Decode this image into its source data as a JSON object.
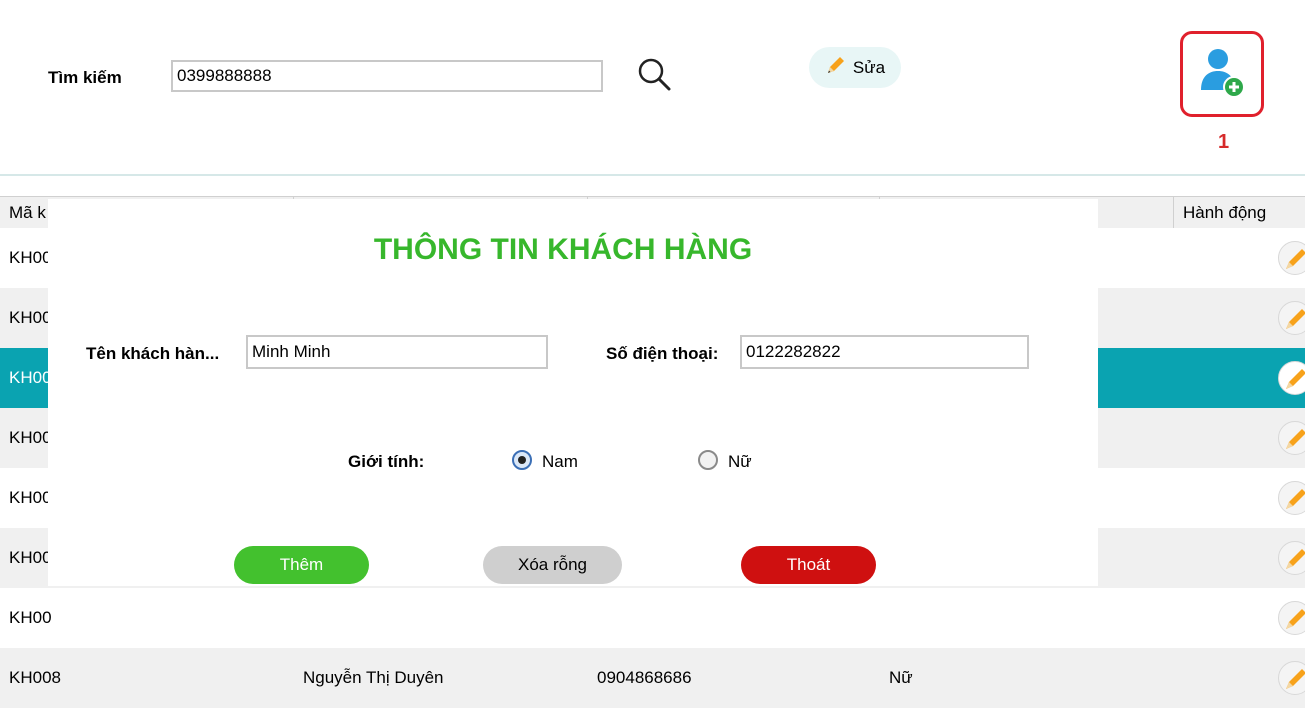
{
  "search": {
    "label": "Tìm kiếm",
    "value": "0399888888"
  },
  "toolbar": {
    "edit_label": "Sửa",
    "step_marker": "1"
  },
  "table": {
    "headers": [
      "Mã k",
      "",
      "",
      "",
      "Hành động"
    ],
    "rows": [
      {
        "id": "KH00",
        "name": "",
        "phone": "",
        "gender": ""
      },
      {
        "id": "KH00",
        "name": "",
        "phone": "",
        "gender": ""
      },
      {
        "id": "KH00",
        "name": "",
        "phone": "",
        "gender": ""
      },
      {
        "id": "KH00",
        "name": "",
        "phone": "",
        "gender": ""
      },
      {
        "id": "KH00",
        "name": "",
        "phone": "",
        "gender": ""
      },
      {
        "id": "KH00",
        "name": "",
        "phone": "",
        "gender": ""
      },
      {
        "id": "KH00",
        "name": "",
        "phone": "",
        "gender": ""
      },
      {
        "id": "KH008",
        "name": "Nguyễn Thị Duyên",
        "phone": "0904868686",
        "gender": "Nữ"
      }
    ]
  },
  "dialog": {
    "title": "THÔNG TIN KHÁCH HÀNG",
    "name_label": "Tên khách hàn...",
    "name_value": "Minh Minh",
    "phone_label": "Số điện thoại:",
    "phone_value": "0122282822",
    "gender_label": "Giới tính:",
    "gender_options": [
      "Nam",
      "Nữ"
    ],
    "gender_selected": "Nam",
    "buttons": {
      "add": "Thêm",
      "clear": "Xóa rỗng",
      "exit": "Thoát"
    }
  },
  "colors": {
    "title_green": "#37b72c",
    "selected_row": "#0aa3b1",
    "add_button": "#43c12e",
    "exit_button": "#cf1010",
    "highlight_box": "#e0202c"
  }
}
